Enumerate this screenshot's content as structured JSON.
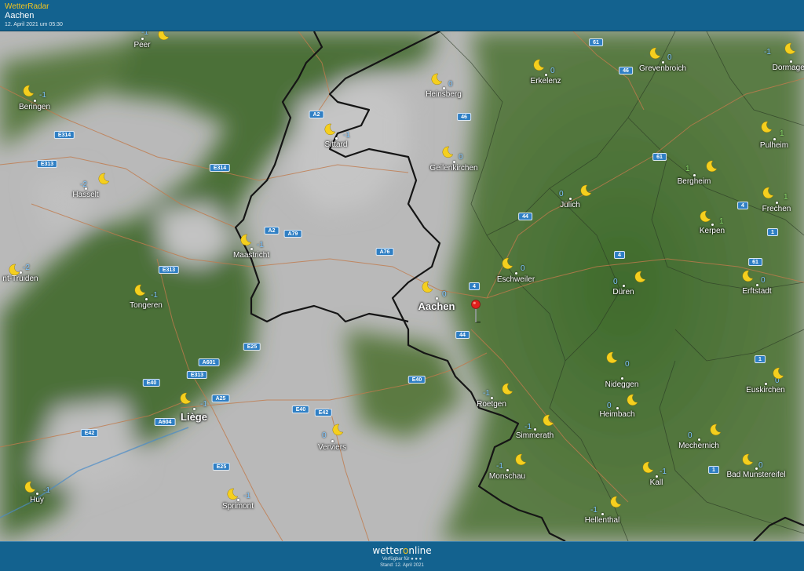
{
  "header": {
    "app_title": "WetterRadar",
    "location": "Aachen",
    "timestamp": "12. April 2021 um 05:30"
  },
  "map": {
    "weather_icon": "moon-icon",
    "colors": {
      "land_green": "#4f6e38",
      "cloud_gray": "#b9b9b9",
      "border": "#151515",
      "road": "#c07a4c",
      "shield": "#2f7fc4",
      "temp_blue": "#7fc7ff",
      "temp_green": "#8bde6a",
      "moon": "#f5cf1e",
      "pin": "#e0201d"
    },
    "cities": [
      {
        "name": "Peer",
        "temp": "-1",
        "tc": "blue",
        "big": false
      },
      {
        "name": "Beringen",
        "temp": "-1",
        "tc": "blue",
        "big": false
      },
      {
        "name": "Hasselt",
        "temp": "-2",
        "tc": "blue",
        "big": false
      },
      {
        "name": "nt-Truiden",
        "temp": "-2",
        "tc": "blue",
        "big": false
      },
      {
        "name": "Tongeren",
        "temp": "-1",
        "tc": "blue",
        "big": false
      },
      {
        "name": "Maastricht",
        "temp": "-1",
        "tc": "blue",
        "big": false
      },
      {
        "name": "Sittard",
        "temp": "-1",
        "tc": "blue",
        "big": false
      },
      {
        "name": "Heinsberg",
        "temp": "0",
        "tc": "blue",
        "big": false
      },
      {
        "name": "Erkelenz",
        "temp": "0",
        "tc": "blue",
        "big": false
      },
      {
        "name": "Grevenbroich",
        "temp": "0",
        "tc": "blue",
        "big": false
      },
      {
        "name": "Dormagen",
        "temp": "-1",
        "tc": "blue",
        "big": false
      },
      {
        "name": "Geilenkirchen",
        "temp": "0",
        "tc": "blue",
        "big": false
      },
      {
        "name": "Pulheim",
        "temp": "1",
        "tc": "green",
        "big": false
      },
      {
        "name": "Bergheim",
        "temp": "1",
        "tc": "green",
        "big": false
      },
      {
        "name": "Jülich",
        "temp": "0",
        "tc": "blue",
        "big": false
      },
      {
        "name": "Frechen",
        "temp": "1",
        "tc": "green",
        "big": false
      },
      {
        "name": "Kerpen",
        "temp": "1",
        "tc": "green",
        "big": false
      },
      {
        "name": "Eschweiler",
        "temp": "0",
        "tc": "blue",
        "big": false
      },
      {
        "name": "Düren",
        "temp": "0",
        "tc": "blue",
        "big": false
      },
      {
        "name": "Erftstadt",
        "temp": "0",
        "tc": "blue",
        "big": false
      },
      {
        "name": "Aachen",
        "temp": "0",
        "tc": "blue",
        "big": true
      },
      {
        "name": "Nideggen",
        "temp": "0",
        "tc": "blue",
        "big": false
      },
      {
        "name": "Euskirchen",
        "temp": "0",
        "tc": "blue",
        "big": false
      },
      {
        "name": "Liège",
        "temp": "-1",
        "tc": "blue",
        "big": true
      },
      {
        "name": "Roetgen",
        "temp": "-1",
        "tc": "blue",
        "big": false
      },
      {
        "name": "Heimbach",
        "temp": "0",
        "tc": "blue",
        "big": false
      },
      {
        "name": "Simmerath",
        "temp": "-1",
        "tc": "blue",
        "big": false
      },
      {
        "name": "Verviers",
        "temp": "0",
        "tc": "blue",
        "big": false
      },
      {
        "name": "Mechernich",
        "temp": "0",
        "tc": "blue",
        "big": false
      },
      {
        "name": "Monschau",
        "temp": "-1",
        "tc": "blue",
        "big": false
      },
      {
        "name": "Kall",
        "temp": "-1",
        "tc": "blue",
        "big": false
      },
      {
        "name": "Bad Munstereifel",
        "temp": "0",
        "tc": "blue",
        "big": false
      },
      {
        "name": "Huy",
        "temp": "-1",
        "tc": "blue",
        "big": false
      },
      {
        "name": "Sprimont",
        "temp": "-1",
        "tc": "blue",
        "big": false
      },
      {
        "name": "Hellenthal",
        "temp": "-1",
        "tc": "blue",
        "big": false
      }
    ],
    "roads": [
      "61",
      "46",
      "A2",
      "46",
      "E314",
      "E313",
      "E314",
      "61",
      "A2",
      "A79",
      "44",
      "4",
      "A76",
      "1",
      "E313",
      "4",
      "61",
      "4",
      "E25",
      "44",
      "1",
      "A601",
      "E313",
      "E40",
      "E40",
      "A25",
      "E40",
      "E42",
      "A604",
      "E42",
      "E25",
      "1"
    ]
  },
  "footer": {
    "brand_a": "wetter",
    "brand_o": "o",
    "brand_b": "nline",
    "line1": "Verfügbar für ● ● ●",
    "line2": "Stand: 12. April 2021"
  }
}
